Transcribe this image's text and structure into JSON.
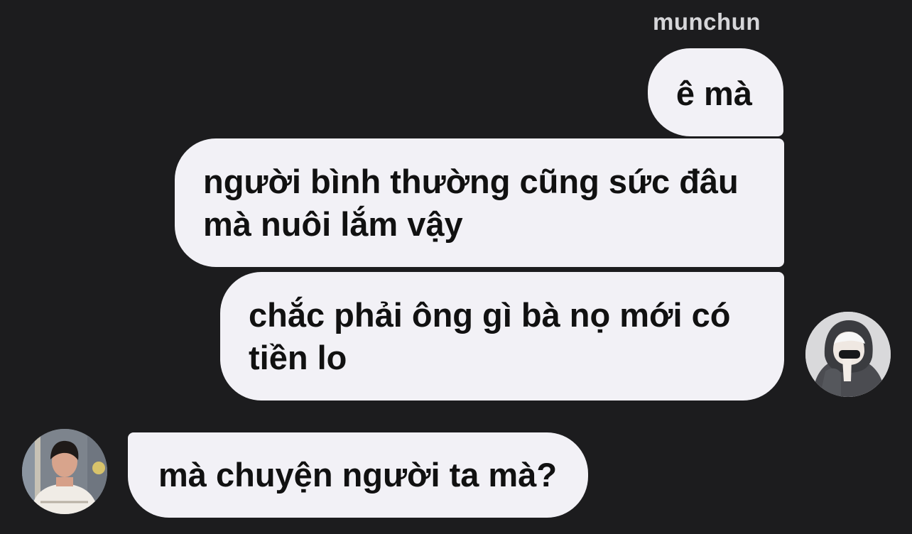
{
  "chat": {
    "sender_name": "munchun",
    "messages": [
      {
        "side": "right",
        "lines": [
          "ê mà"
        ]
      },
      {
        "side": "right",
        "lines": [
          "người bình thường cũng sức đâu",
          "mà nuôi lắm vậy"
        ]
      },
      {
        "side": "right",
        "lines": [
          "chắc phải ông gì bà nọ mới có",
          "tiền lo"
        ]
      },
      {
        "side": "left",
        "lines": [
          "mà chuyện người ta mà?"
        ]
      }
    ]
  },
  "colors": {
    "background": "#1c1c1e",
    "bubble": "#f2f1f6",
    "message_text": "#111111",
    "sender_name": "#d6d6d9"
  },
  "icons": {
    "avatar_right": "avatar-hooded-person",
    "avatar_left": "avatar-young-man"
  }
}
